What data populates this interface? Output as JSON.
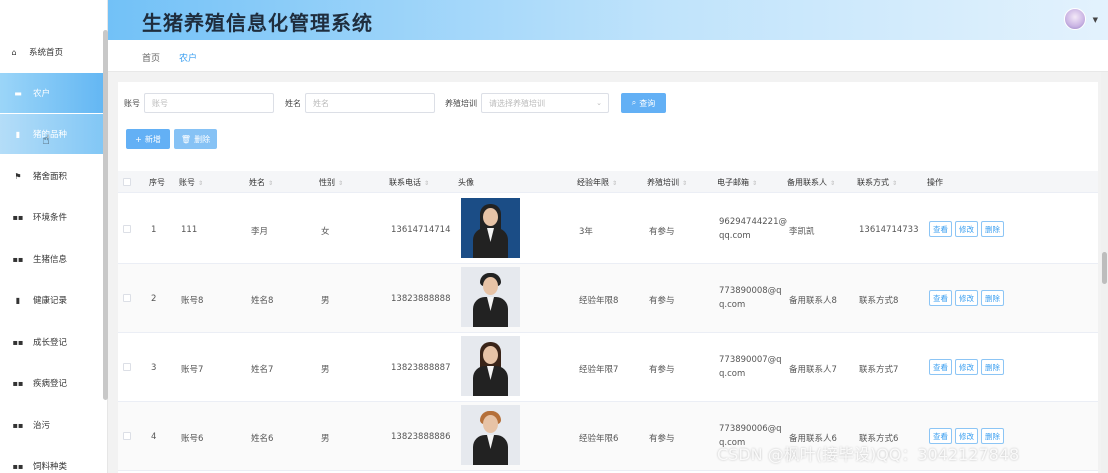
{
  "header": {
    "title": "生猪养殖信息化管理系统"
  },
  "breadcrumb": [
    "首页",
    "农户"
  ],
  "sidebar": {
    "items": [
      {
        "label": "系统首页",
        "icon": "home-icon"
      },
      {
        "label": "农户",
        "icon": "user-card-icon"
      },
      {
        "label": "猪的品种",
        "icon": "briefcase-icon"
      },
      {
        "label": "猪舍面积",
        "icon": "flag-icon"
      },
      {
        "label": "环境条件",
        "icon": "grid-icon"
      },
      {
        "label": "生猪信息",
        "icon": "grid-icon"
      },
      {
        "label": "健康记录",
        "icon": "clipboard-icon"
      },
      {
        "label": "成长登记",
        "icon": "grid-icon"
      },
      {
        "label": "疾病登记",
        "icon": "grid-icon"
      },
      {
        "label": "治污",
        "icon": "grid-icon"
      },
      {
        "label": "饲料种类",
        "icon": "grid-icon"
      }
    ]
  },
  "search": {
    "account_label": "账号",
    "account_placeholder": "账号",
    "name_label": "姓名",
    "name_placeholder": "姓名",
    "training_label": "养殖培训",
    "training_placeholder": "请选择养殖培训",
    "query_label": "查询"
  },
  "actions": {
    "add_label": "新增",
    "delete_label": "删除"
  },
  "table": {
    "headers": [
      "序号",
      "账号",
      "姓名",
      "性别",
      "联系电话",
      "头像",
      "经验年限",
      "养殖培训",
      "电子邮箱",
      "备用联系人",
      "联系方式",
      "操作"
    ],
    "rows": [
      {
        "index": "1",
        "account": "111",
        "name": "李月",
        "gender": "女",
        "phone": "13614714714",
        "experience": "3年",
        "training": "有参与",
        "email": "96294744221@qq.com",
        "backup": "李凯凯",
        "contact": "13614714733"
      },
      {
        "index": "2",
        "account": "账号8",
        "name": "姓名8",
        "gender": "男",
        "phone": "13823888888",
        "experience": "经验年限8",
        "training": "有参与",
        "email": "773890008@qq.com",
        "backup": "备用联系人8",
        "contact": "联系方式8"
      },
      {
        "index": "3",
        "account": "账号7",
        "name": "姓名7",
        "gender": "男",
        "phone": "13823888887",
        "experience": "经验年限7",
        "training": "有参与",
        "email": "773890007@qq.com",
        "backup": "备用联系人7",
        "contact": "联系方式7"
      },
      {
        "index": "4",
        "account": "账号6",
        "name": "姓名6",
        "gender": "男",
        "phone": "13823888886",
        "experience": "经验年限6",
        "training": "有参与",
        "email": "773890006@qq.com",
        "backup": "备用联系人6",
        "contact": "联系方式6"
      }
    ],
    "op_labels": {
      "view": "查看",
      "edit": "修改",
      "delete": "删除"
    }
  },
  "watermark": "CSDN @枫叶(接毕设)QQ：3042127848",
  "colors": {
    "accent": "#3b9ff0",
    "header_gradient_start": "#72c1f7",
    "active_sidebar": "#62b6f3"
  }
}
